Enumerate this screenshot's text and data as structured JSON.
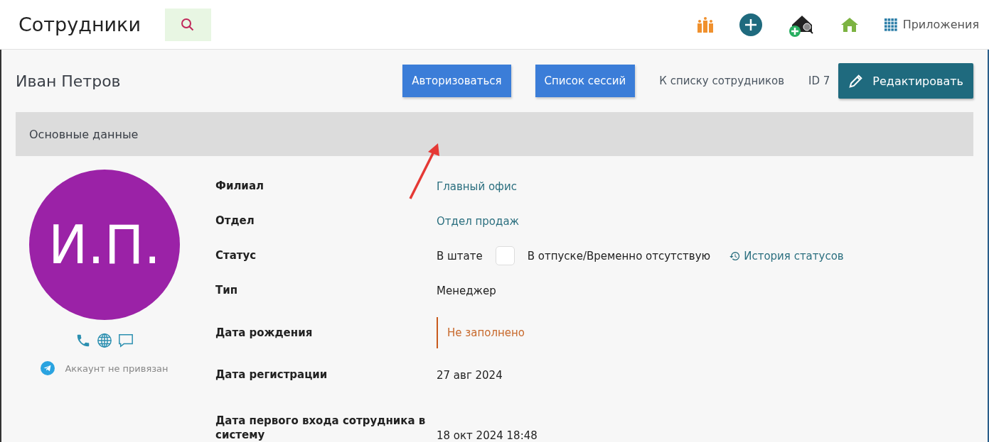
{
  "header": {
    "title": "Сотрудники",
    "apps_label": "Приложения"
  },
  "profile": {
    "name": "Иван Петров",
    "buttons": [
      {
        "label": "Авторизоваться"
      },
      {
        "label": "Список сессий"
      }
    ],
    "back_link": "К списку сотрудников",
    "id_label": "ID 7",
    "edit_button": "Редактировать"
  },
  "section": {
    "title": "Основные данные"
  },
  "avatar": {
    "initials": "И.П.",
    "color": "#9b22a7"
  },
  "telegram": {
    "label": "Аккаунт не привязан"
  },
  "fields": [
    {
      "kind": "link",
      "label": "Филиал",
      "value": "Главный офис"
    },
    {
      "kind": "link",
      "label": "Отдел",
      "value": "Отдел продаж"
    },
    {
      "kind": "status",
      "label": "Статус",
      "value": "В штате",
      "alt_value": "В отпуске/Временно отсутствую",
      "checked": false,
      "history_link": "История статусов"
    },
    {
      "kind": "text",
      "label": "Тип",
      "value": "Менеджер"
    },
    {
      "kind": "empty",
      "label": "Дата рождения",
      "value": "Не заполнено"
    },
    {
      "kind": "text",
      "label": "Дата регистрации",
      "value": "27 авг 2024"
    },
    {
      "kind": "text",
      "label": "Дата первого входа сотрудника в систему",
      "value": "18 окт 2024 18:48"
    }
  ]
}
